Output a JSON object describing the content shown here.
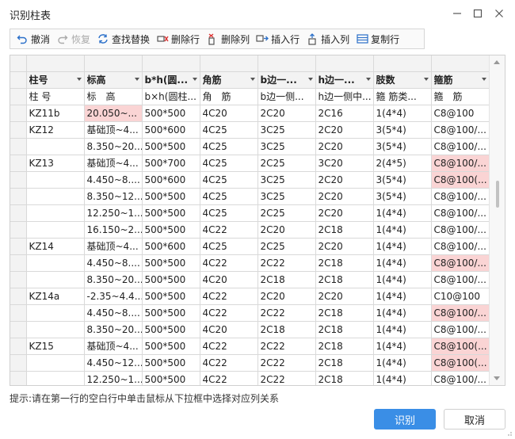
{
  "window": {
    "title": "识别柱表"
  },
  "toolbar": [
    {
      "name": "undo",
      "label": "撤消",
      "disabled": false,
      "icon": "undo-icon"
    },
    {
      "name": "redo",
      "label": "恢复",
      "disabled": true,
      "icon": "redo-icon"
    },
    {
      "name": "find-replace",
      "label": "查找替换",
      "disabled": false,
      "icon": "find-replace-icon"
    },
    {
      "name": "delete-row",
      "label": "删除行",
      "disabled": false,
      "icon": "delete-row-icon"
    },
    {
      "name": "delete-col",
      "label": "删除列",
      "disabled": false,
      "icon": "delete-col-icon"
    },
    {
      "name": "insert-row",
      "label": "插入行",
      "disabled": false,
      "icon": "insert-row-icon"
    },
    {
      "name": "insert-col",
      "label": "插入列",
      "disabled": false,
      "icon": "insert-col-icon"
    },
    {
      "name": "copy-row",
      "label": "复制行",
      "disabled": false,
      "icon": "copy-row-icon"
    }
  ],
  "table": {
    "headers": [
      "柱号",
      "标高",
      "b*h(圆...",
      "角筋",
      "b边一...",
      "h边一...",
      "肢数",
      "箍筋"
    ],
    "subheaders": [
      "柱 号",
      "标　高",
      "b×h(圆柱...",
      "角　筋",
      "b边一侧...",
      "h边一侧中...",
      "箍 筋类...",
      "箍　筋"
    ],
    "rows": [
      {
        "cells": [
          "KZ11b",
          "20.050~...",
          "500*500",
          "4C20",
          "2C20",
          "2C16",
          "1(4*4)",
          "C8@100"
        ],
        "pink": [
          1
        ]
      },
      {
        "cells": [
          "KZ12",
          "基础顶~4...",
          "500*600",
          "4C25",
          "3C25",
          "2C20",
          "3(5*4)",
          "C8@100/..."
        ],
        "pink": []
      },
      {
        "cells": [
          "",
          "8.350~20...",
          "500*500",
          "4C25",
          "3C25",
          "2C20",
          "3(5*4)",
          "C8@100/..."
        ],
        "pink": []
      },
      {
        "cells": [
          "KZ13",
          "基础顶~4...",
          "500*700",
          "4C25",
          "2C25",
          "3C20",
          "2(4*5)",
          "C8@100/..."
        ],
        "pink": [
          7
        ]
      },
      {
        "cells": [
          "",
          "4.450~8....",
          "500*600",
          "4C25",
          "3C25",
          "2C20",
          "3(5*4)",
          "C8@100(..."
        ],
        "pink": [
          7
        ]
      },
      {
        "cells": [
          "",
          "8.350~12...",
          "500*500",
          "4C25",
          "3C25",
          "2C20",
          "3(5*4)",
          "C8@100/..."
        ],
        "pink": []
      },
      {
        "cells": [
          "",
          "12.250~1...",
          "500*500",
          "4C25",
          "2C25",
          "2C20",
          "1(4*4)",
          "C8@100/..."
        ],
        "pink": []
      },
      {
        "cells": [
          "",
          "16.150~2...",
          "500*500",
          "4C22",
          "2C20",
          "2C18",
          "1(4*4)",
          "C8@100/..."
        ],
        "pink": []
      },
      {
        "cells": [
          "KZ14",
          "基础顶~4...",
          "500*600",
          "4C25",
          "2C25",
          "2C20",
          "1(4*4)",
          "C8@100/..."
        ],
        "pink": []
      },
      {
        "cells": [
          "",
          "4.450~8....",
          "500*500",
          "4C22",
          "2C22",
          "2C18",
          "1(4*4)",
          "C8@100/..."
        ],
        "pink": [
          7
        ]
      },
      {
        "cells": [
          "",
          "8.350~20...",
          "500*500",
          "4C20",
          "2C18",
          "2C18",
          "1(4*4)",
          "C8@100/..."
        ],
        "pink": []
      },
      {
        "cells": [
          "KZ14a",
          "-2.35~4.4...",
          "500*500",
          "4C22",
          "2C20",
          "2C20",
          "1(4*4)",
          "C10@100"
        ],
        "pink": []
      },
      {
        "cells": [
          "",
          "4.450~8....",
          "500*500",
          "4C22",
          "2C22",
          "2C18",
          "1(4*4)",
          "C8@100/..."
        ],
        "pink": [
          7
        ]
      },
      {
        "cells": [
          "",
          "8.350~20...",
          "500*500",
          "4C20",
          "2C18",
          "2C18",
          "1(4*4)",
          "C8@100/..."
        ],
        "pink": []
      },
      {
        "cells": [
          "KZ15",
          "基础顶~4...",
          "500*500",
          "4C22",
          "2C22",
          "2C18",
          "1(4*4)",
          "C8@100(..."
        ],
        "pink": [
          7
        ]
      },
      {
        "cells": [
          "",
          "4.450~12...",
          "500*500",
          "4C22",
          "2C22",
          "2C18",
          "1(4*4)",
          "C8@100(..."
        ],
        "pink": [
          7
        ]
      },
      {
        "cells": [
          "",
          "12.250~1...",
          "500*500",
          "4C22",
          "2C22",
          "2C18",
          "1(4*4)",
          "C8@100/..."
        ],
        "pink": []
      }
    ]
  },
  "hint": "提示:请在第一行的空白行中单击鼠标从下拉框中选择对应列关系",
  "buttons": {
    "ok": "识别",
    "cancel": "取消"
  },
  "colors": {
    "accent": "#3a8ee6",
    "highlight": "#fad4d4",
    "header_bg": "#f3f3f3"
  }
}
